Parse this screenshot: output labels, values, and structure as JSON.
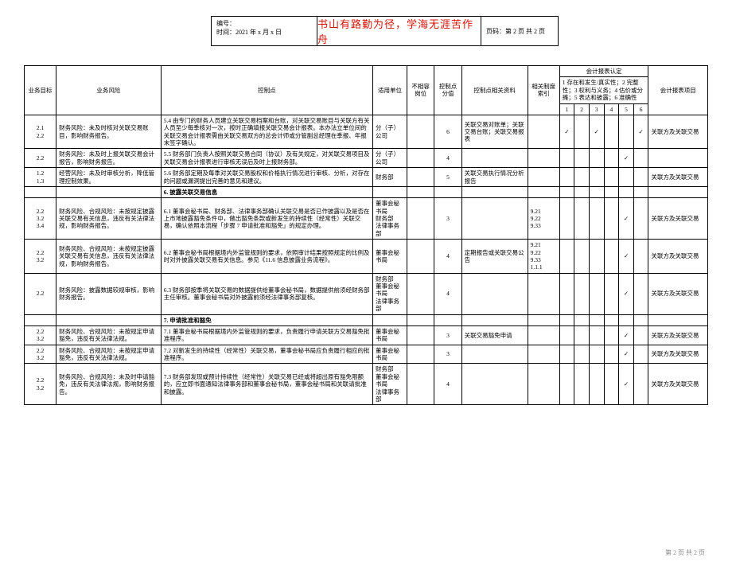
{
  "header": {
    "line1": "编号：",
    "line2": "时间：2021 年 x 月 x 日",
    "motto": "书山有路勤为径，学海无涯苦作舟",
    "page": "页码：第 2 页 共 2 页"
  },
  "columns": {
    "objective": "业务目标",
    "risk": "业务风险",
    "control": "控制点",
    "unit": "适用单位",
    "position": "不相容岗位",
    "score": "控制点分值",
    "material": "控制点相关资料",
    "index": "相关制度索引",
    "assert_group": "会计报表认定",
    "assert_note": "1 存在和发生/真实性；2 完整性；3 权利与义务；4 估价或分摊；5 表达和披露；6 准确性",
    "assert_nums": [
      "1",
      "2",
      "3",
      "4",
      "5",
      "6"
    ],
    "item": "会计报表项目"
  },
  "rows": [
    {
      "objective": "2.1\n2.2",
      "risk": "财务风险：未及时核对关联交易账目，影响财务报告。",
      "control": "5.4 由专门的财务人员建立关联交易档案和台账，对关联交易账目与关联方有关人员至少每季核对一次，按时正确填报关联交易会计报表。本办法立单位间的关联交易会计报表需由关联交易双方的总会计师或分管副总经理在季报、年报末签字确认。",
      "unit": "分（子）公司",
      "position": "",
      "score": "6",
      "material": "关联交易对账单；关联交易台账；关联交易报表",
      "index": "",
      "checks": [
        "✓",
        "",
        "✓",
        "",
        "",
        "✓"
      ],
      "item": "关联方及关联交易"
    },
    {
      "objective": "2.2",
      "risk": "财务风险：未及时上报关联交易会计报告，影响财务报告。",
      "control": "5.5 财务部门负责人按照关联交易合同（协议）及有关规定，对关联交易项目及关联交易会计报表进行审核无误后及时上报财务部。",
      "unit": "分（子）公司",
      "position": "",
      "score": "4",
      "material": "",
      "index": "",
      "checks": [
        "",
        "",
        "",
        "",
        "✓",
        ""
      ],
      "item": ""
    },
    {
      "objective": "1.2\n1.3",
      "risk": "经营风险：未及时审核分析，降低管理控制效果。",
      "control": "5.6 财务部定期及每季对关联交易股权和价格执行情况进行审核、分析，对存在的问题或漏洞提出完善的意见和建议。",
      "unit": "财务部",
      "position": "",
      "score": "5",
      "material": "关联交易执行情况分析报告",
      "index": "",
      "checks": [
        "",
        "",
        "",
        "",
        "",
        ""
      ],
      "item": "关联方及关联交易"
    },
    {
      "section": "6. 披露关联交易信息"
    },
    {
      "objective": "2.2\n3.2\n3.4",
      "risk": "财务风险、合规风险：未按规定披露关联交易有关信息，违反有关法律法规，影响财务报告。",
      "control": "6.1 董事会秘书局、财务部、法律事务部确认关联交易是否已作披露以及是否在上市地披露豁免条件中，做出豁免条款或新发生的持续性（经常性）关联交易，确认依照本流程「步骤 7 申请批准和豁免」的规定办理。",
      "unit": "董事会秘书局\n财务部\n法律事务部",
      "position": "",
      "score": "3",
      "material": "",
      "index": "9.21\n9.22\n9.33",
      "checks": [
        "",
        "",
        "",
        "",
        "✓",
        ""
      ],
      "item": "关联方及关联交易"
    },
    {
      "objective": "2.2\n3.2",
      "risk": "财务风险、合规风险：未按规定披露关联交易有关信息，违反有关法律法规，影响财务报告。",
      "control": "6.2 董事会秘书局根据境内外监管规则的要求，依照审计结果按照规定的比例及时对外披露关联交易有关信息。参见《11.6 信息披露业务流程》。",
      "unit": "董事会秘书局",
      "position": "",
      "score": "4",
      "material": "定期报告或关联交易公告",
      "index": "9.21\n9.22\n9.33\n1.1.1",
      "checks": [
        "",
        "",
        "",
        "",
        "✓",
        ""
      ],
      "item": "关联方及关联交易"
    },
    {
      "objective": "2.2",
      "risk": "财务风险：披露数据较规审核，影响财务报告。",
      "control": "6.3 财务部按季将关联交易的数据提供给董事会秘书局，数据提供前须经财务部主任审核。董事会秘书局对外披露前须经法律事务部复核。",
      "unit": "财务部\n董事会秘书局\n法律事务部",
      "position": "",
      "score": "4",
      "material": "",
      "index": "",
      "checks": [
        "",
        "",
        "",
        "",
        "✓",
        ""
      ],
      "item": "关联方及关联交易"
    },
    {
      "section": "7. 申请批准和豁免"
    },
    {
      "objective": "2.2\n3.2",
      "risk": "财务风险、合规风险：未按规定申请豁免，违反有关法律法规。",
      "control": "7.1 董事会秘书局根据境内外监管规则的要求，负责履行申请关联方交易豁免批准程序。",
      "unit": "董事会秘书局",
      "position": "",
      "score": "3",
      "material": "关联交易豁免申请",
      "index": "",
      "checks": [
        "",
        "",
        "",
        "",
        "✓",
        ""
      ],
      "item": "关联方及关联交易"
    },
    {
      "objective": "2.2\n3.2",
      "risk": "财务风险、合规风险：未按规定申请豁免，违反有关法律法规。",
      "control": "7.2 对新发生的持续性（经常性）关联交易，董事会秘书局应负责履行相应的批准程序。",
      "unit": "董事会秘书局",
      "position": "",
      "score": "3",
      "material": "",
      "index": "",
      "checks": [
        "",
        "",
        "",
        "",
        "✓",
        ""
      ],
      "item": "关联方及关联交易"
    },
    {
      "objective": "2.2\n3.2",
      "risk": "财务风险、合规风险：未及时申请豁免，违反有关法律法规，影响财务报告。",
      "control": "7.3 财务部发现或预计持续性（经常性）关联交易已经或将超出原有豁免限额的，应立即书面通知法律事务部和董事会秘书局，董事会秘书局和关联请批准和披露。",
      "unit": "财务部\n董事会秘书局\n法律事务部",
      "position": "",
      "score": "4",
      "material": "",
      "index": "",
      "checks": [
        "",
        "",
        "",
        "",
        "✓",
        ""
      ],
      "item": "关联方及关联交易"
    }
  ],
  "footer": "第 2 页 共 2 页"
}
